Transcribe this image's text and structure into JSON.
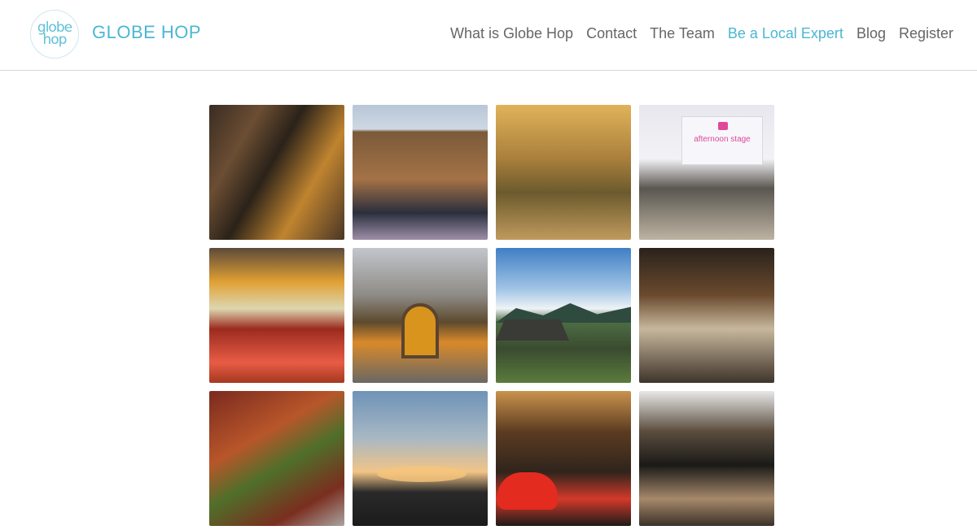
{
  "brand": {
    "logo_text_top": "globe",
    "logo_text_bottom": "hop",
    "name": "GLOBE HOP"
  },
  "nav": {
    "items": [
      {
        "label": "What is Globe Hop"
      },
      {
        "label": "Contact"
      },
      {
        "label": "The Team"
      },
      {
        "label": "Be a Local Expert"
      },
      {
        "label": "Blog"
      },
      {
        "label": "Register"
      }
    ]
  },
  "gallery": {
    "banner_text": "afternoon stage",
    "photos": [
      {
        "icon": "cafe-photo"
      },
      {
        "icon": "terrace-photo"
      },
      {
        "icon": "autumn-park-photo"
      },
      {
        "icon": "concert-photo"
      },
      {
        "icon": "food-platter-photo"
      },
      {
        "icon": "cathedral-photo"
      },
      {
        "icon": "mountain-village-photo"
      },
      {
        "icon": "restaurant-interior-photo"
      },
      {
        "icon": "spicy-dish-photo"
      },
      {
        "icon": "sunset-photo"
      },
      {
        "icon": "red-car-shop-photo"
      },
      {
        "icon": "staircase-interior-photo"
      }
    ]
  },
  "colors": {
    "accent": "#4bb7d4",
    "nav_text": "#666666",
    "divider": "#d6d6d6"
  }
}
